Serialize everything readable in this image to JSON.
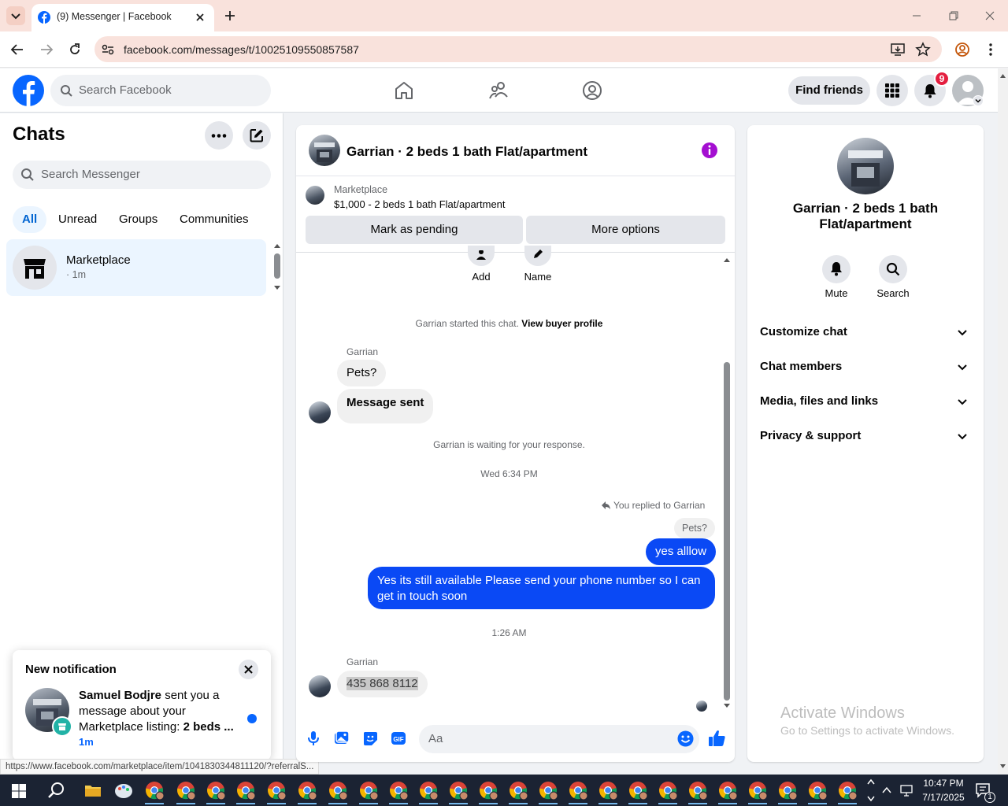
{
  "browser": {
    "tab_title": "(9) Messenger | Facebook",
    "url": "facebook.com/messages/t/10025109550857587"
  },
  "fb_header": {
    "search_placeholder": "Search Facebook",
    "find_friends_label": "Find friends",
    "notification_count": "9"
  },
  "sidebar": {
    "title": "Chats",
    "search_placeholder": "Search Messenger",
    "filters": [
      "All",
      "Unread",
      "Groups",
      "Communities"
    ],
    "chat_item": {
      "name": "Marketplace",
      "time": "· 1m"
    }
  },
  "notification": {
    "title": "New notification",
    "sender": "Samuel Bodjre",
    "text_middle": " sent you a message about your Marketplace listing: ",
    "text_bold_end": "2 beds ...",
    "time": "1m"
  },
  "status_url": "https://www.facebook.com/marketplace/item/1041830344811120/?referralS...",
  "conversation": {
    "title": "Garrian · 2 beds 1 bath Flat/apartment",
    "marketplace_label": "Marketplace",
    "listing": "$1,000 - 2 beds 1 bath Flat/apartment",
    "mark_pending_label": "Mark as pending",
    "more_options_label": "More options",
    "add_label": "Add",
    "name_label": "Name",
    "started_text": "Garrian started this chat.",
    "view_buyer_label": "View buyer profile",
    "sender_name": "Garrian",
    "msg_pets": "Pets?",
    "msg_sent": "Message sent",
    "waiting_text": "Garrian is waiting for your response.",
    "timestamp_1": "Wed 6:34 PM",
    "replied_text": "You replied to Garrian",
    "quoted_text": "Pets?",
    "msg_yes": "yes alllow",
    "msg_available": "Yes its still available Please send your phone number so I can get in touch soon",
    "timestamp_2": "1:26 AM",
    "msg_phone": "435 868 8112",
    "composer_placeholder": "Aa"
  },
  "right_panel": {
    "name": "Garrian · 2 beds 1 bath Flat/apartment",
    "mute_label": "Mute",
    "search_label": "Search",
    "sections": [
      "Customize chat",
      "Chat members",
      "Media, files and links",
      "Privacy & support"
    ]
  },
  "watermark": {
    "line1": "Activate Windows",
    "line2": "Go to Settings to activate Windows."
  },
  "taskbar": {
    "time": "10:47 PM",
    "date": "7/17/2025",
    "notification_badge": "1"
  },
  "colors": {
    "accent": "#0866ff",
    "outgoing_bubble": "#0a49f5",
    "tab_bar": "#f9e2dc",
    "badge": "#e41e3f"
  }
}
